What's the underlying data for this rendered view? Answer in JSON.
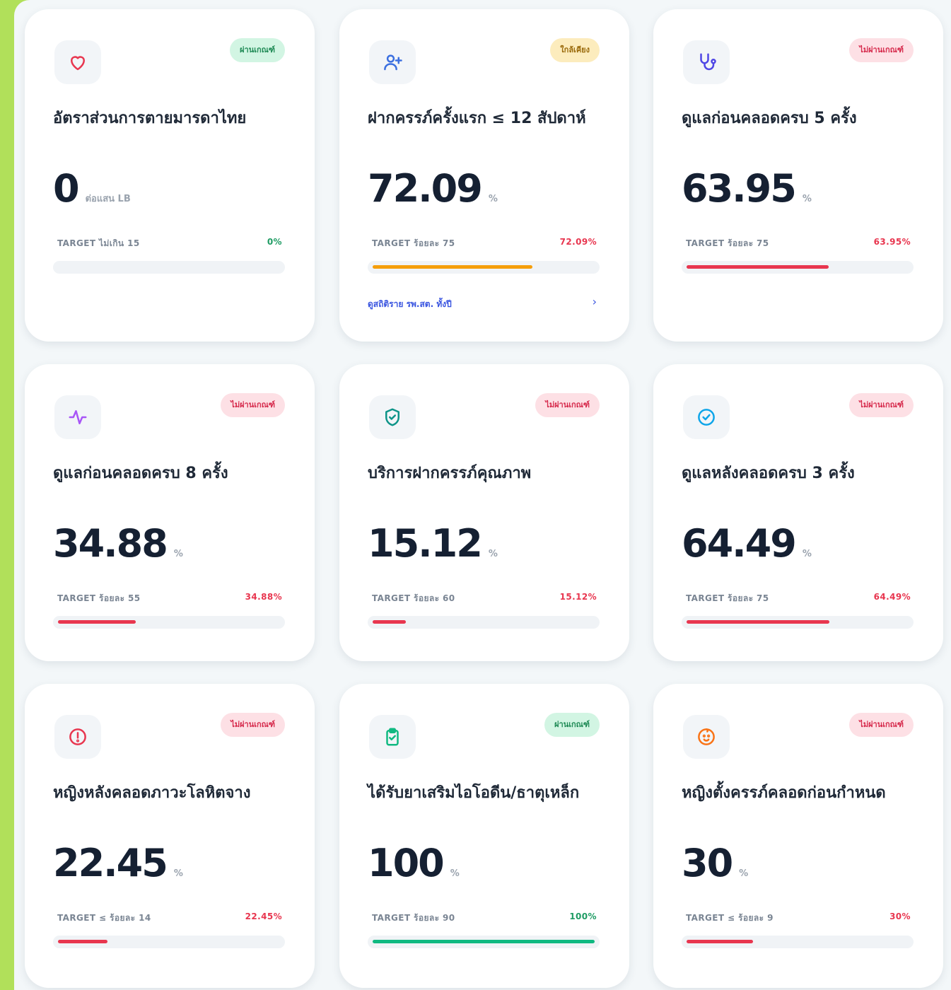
{
  "cards": [
    {
      "title": "อัตราส่วนการตายมารดาไทย",
      "value": "0",
      "unit": "ต่อแสน LB",
      "target": "TARGET ไม่เกิน 15",
      "percent_text": "0%",
      "progress": 0,
      "status": "ผ่านเกณฑ์",
      "status_kind": "pass",
      "icon": "heart-icon",
      "accent": "#e8364f",
      "bar_color": "#e8364f",
      "pct_color": "#1f9c64"
    },
    {
      "title": "ฝากครรภ์ครั้งแรก ≤ 12 สัปดาห์",
      "value": "72.09",
      "unit": "%",
      "target": "TARGET ร้อยละ 75",
      "percent_text": "72.09%",
      "progress": 72.09,
      "status": "ใกล้เคียง",
      "status_kind": "near",
      "icon": "user-plus-icon",
      "accent": "#3b6fe0",
      "bar_color": "#f59e0b",
      "pct_color": "#e8364f",
      "link": "ดูสถิติราย รพ.สต. ทั้งปี",
      "link_chevron": "›"
    },
    {
      "title": "ดูแลก่อนคลอดครบ 5 ครั้ง",
      "value": "63.95",
      "unit": "%",
      "target": "TARGET ร้อยละ 75",
      "percent_text": "63.95%",
      "progress": 63.95,
      "status": "ไม่ผ่านเกณฑ์",
      "status_kind": "fail",
      "icon": "stethoscope-icon",
      "accent": "#4f46e5",
      "bar_color": "#e8364f",
      "pct_color": "#e8364f"
    },
    {
      "title": "ดูแลก่อนคลอดครบ 8 ครั้ง",
      "value": "34.88",
      "unit": "%",
      "target": "TARGET ร้อยละ 55",
      "percent_text": "34.88%",
      "progress": 34.88,
      "status": "ไม่ผ่านเกณฑ์",
      "status_kind": "fail",
      "icon": "activity-icon",
      "accent": "#a855f7",
      "bar_color": "#e8364f",
      "pct_color": "#e8364f"
    },
    {
      "title": "บริการฝากครรภ์คุณภาพ",
      "value": "15.12",
      "unit": "%",
      "target": "TARGET ร้อยละ 60",
      "percent_text": "15.12%",
      "progress": 15.12,
      "status": "ไม่ผ่านเกณฑ์",
      "status_kind": "fail",
      "icon": "shield-check-icon",
      "accent": "#0d9488",
      "bar_color": "#e8364f",
      "pct_color": "#e8364f"
    },
    {
      "title": "ดูแลหลังคลอดครบ 3 ครั้ง",
      "value": "64.49",
      "unit": "%",
      "target": "TARGET ร้อยละ 75",
      "percent_text": "64.49%",
      "progress": 64.49,
      "status": "ไม่ผ่านเกณฑ์",
      "status_kind": "fail",
      "icon": "check-circle-icon",
      "accent": "#0ea5e9",
      "bar_color": "#e8364f",
      "pct_color": "#e8364f"
    },
    {
      "title": "หญิงหลังคลอดภาวะโลหิตจาง",
      "value": "22.45",
      "unit": "%",
      "target": "TARGET ≤ ร้อยละ 14",
      "percent_text": "22.45%",
      "progress": 22.45,
      "status": "ไม่ผ่านเกณฑ์",
      "status_kind": "fail",
      "icon": "alert-circle-icon",
      "accent": "#e8364f",
      "bar_color": "#e8364f",
      "pct_color": "#e8364f"
    },
    {
      "title": "ได้รับยาเสริมไอโอดีน/ธาตุเหล็ก",
      "value": "100",
      "unit": "%",
      "target": "TARGET ร้อยละ 90",
      "percent_text": "100%",
      "progress": 100,
      "status": "ผ่านเกณฑ์",
      "status_kind": "pass",
      "icon": "clipboard-check-icon",
      "accent": "#10b981",
      "bar_color": "#10b981",
      "pct_color": "#1f9c64"
    },
    {
      "title": "หญิงตั้งครรภ์คลอดก่อนกำหนด",
      "value": "30",
      "unit": "%",
      "target": "TARGET ≤ ร้อยละ 9",
      "percent_text": "30%",
      "progress": 30,
      "status": "ไม่ผ่านเกณฑ์",
      "status_kind": "fail",
      "icon": "baby-icon",
      "accent": "#f97316",
      "bar_color": "#e8364f",
      "pct_color": "#e8364f"
    }
  ]
}
